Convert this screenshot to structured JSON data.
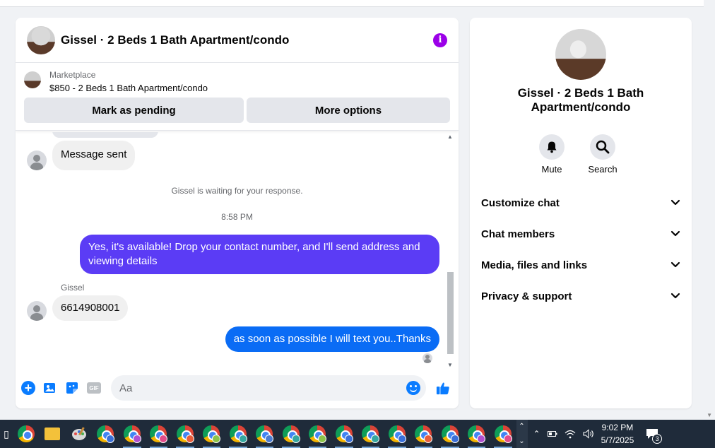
{
  "chat": {
    "title": "Gissel · 2 Beds 1 Bath Apartment/condo",
    "marketplace": {
      "label": "Marketplace",
      "item": "$850 - 2 Beds 1 Bath Apartment/condo",
      "pending_label": "Mark as pending",
      "more_label": "More options"
    },
    "messages": {
      "sent_notice": "Message sent",
      "waiting": "Gissel is waiting for your response.",
      "time": "8:58 PM",
      "out1_line1": "Yes, it's available! Drop your contact number, and I'll send address and",
      "out1_line2": "viewing details",
      "sender": "Gissel",
      "in_phone": "6614908001",
      "out2": "as soon as possible I will text you..Thanks"
    },
    "composer": {
      "placeholder": "Aa",
      "gif_label": "GIF"
    }
  },
  "side": {
    "title": "Gissel · 2 Beds 1 Bath Apartment/condo",
    "actions": [
      {
        "label": "Mute",
        "icon": "bell-icon"
      },
      {
        "label": "Search",
        "icon": "search-icon"
      }
    ],
    "sections": [
      {
        "label": "Customize chat"
      },
      {
        "label": "Chat members"
      },
      {
        "label": "Media, files and links"
      },
      {
        "label": "Privacy & support"
      }
    ]
  },
  "taskbar": {
    "time": "9:02 PM",
    "date": "5/7/2025",
    "notifications": "3",
    "badge_colors": [
      "#3a6fd8",
      "#b04fd0",
      "#e24b8a",
      "#e85d3a",
      "#8bc34a",
      "#35a7a0",
      "#4a7bd0",
      "#35a7a0",
      "#8bc34a",
      "#3a6fd8",
      "#35a7a0",
      "#3a6fd8",
      "#e85d3a",
      "#3a6fd8",
      "#b04fd0",
      "#e24b8a"
    ]
  },
  "colors": {
    "accent": "#0a7cff",
    "outgoing_purple": "#5b3cf5",
    "outgoing_blue": "#0a6cf5",
    "info": "#9b00e8"
  }
}
